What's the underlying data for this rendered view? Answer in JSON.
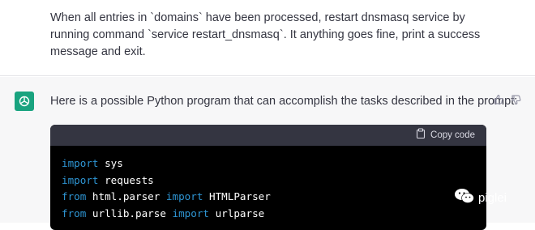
{
  "user_message": {
    "text": "When all entries in `domains` have been processed, restart dnsmasq service by running command `service restart_dnsmasq`. It anything goes fine, print a success message and exit."
  },
  "assistant_message": {
    "avatar_icon": "openai-logo-icon",
    "intro": "Here is a possible Python program that can accomplish the tasks described in the prompt:",
    "feedback_icons": [
      "thumbs-up-icon",
      "thumbs-down-icon"
    ]
  },
  "code_block": {
    "copy_label": "Copy code",
    "lines": [
      {
        "kw": "import",
        "rest": " sys"
      },
      {
        "kw": "import",
        "rest": " requests"
      },
      {
        "kw": "from",
        "mid": " html.parser ",
        "kw2": "import",
        "rest": " HTMLParser"
      },
      {
        "kw": "from",
        "mid": " urllib.parse ",
        "kw2": "import",
        "rest": " urlparse"
      }
    ]
  },
  "watermark": {
    "text": "piglei",
    "icon": "wechat-icon"
  },
  "colors": {
    "assistant_avatar": "#19a37f",
    "code_bg": "#000000",
    "code_header_bg": "#343541",
    "keyword": "#2e95d3"
  }
}
